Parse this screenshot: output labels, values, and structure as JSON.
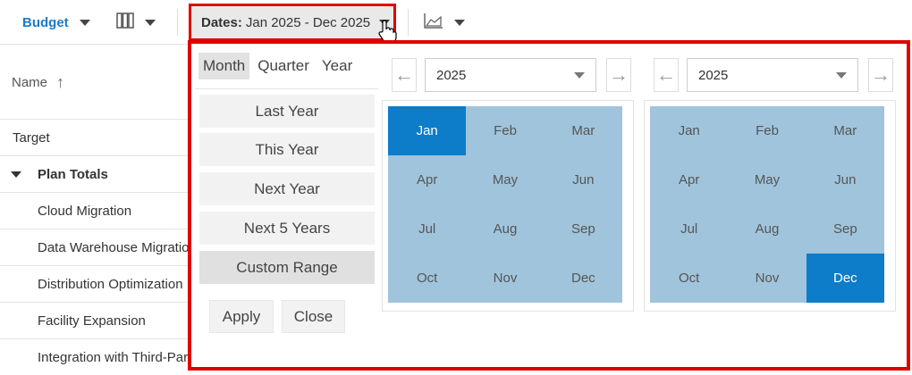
{
  "toolbar": {
    "budget_label": "Budget",
    "columns_icon": "columns-icon",
    "dates_label": "Dates:",
    "dates_value": "Jan 2025 - Dec 2025",
    "chart_icon": "area-chart-icon"
  },
  "grid": {
    "name_header": "Name",
    "sort_icon": "sort-up-arrow-icon",
    "rows": [
      "Target",
      "Plan Totals",
      "Cloud Migration",
      "Data Warehouse Migration",
      "Distribution Optimization",
      "Facility Expansion",
      "Integration with Third-Party"
    ]
  },
  "popup": {
    "tabs": [
      "Month",
      "Quarter",
      "Year"
    ],
    "active_tab": "Month",
    "presets": [
      "Last Year",
      "This Year",
      "Next Year",
      "Next 5 Years",
      "Custom Range"
    ],
    "selected_preset": "Custom Range",
    "apply_label": "Apply",
    "close_label": "Close",
    "prev_icon": "arrow-left-icon",
    "next_icon": "arrow-right-icon",
    "start": {
      "year": "2025",
      "selected_month": "Jan"
    },
    "end": {
      "year": "2025",
      "selected_month": "Dec"
    },
    "months": [
      "Jan",
      "Feb",
      "Mar",
      "Apr",
      "May",
      "Jun",
      "Jul",
      "Aug",
      "Sep",
      "Oct",
      "Nov",
      "Dec"
    ]
  },
  "colors": {
    "accent": "#1a7bc9",
    "selected_month": "#0d7cc9",
    "month_bg": "#a0c4db",
    "highlight_border": "#e00000"
  }
}
